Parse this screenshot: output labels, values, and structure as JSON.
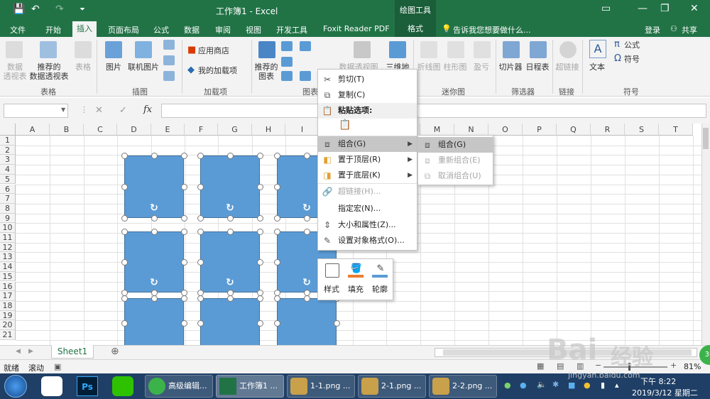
{
  "titlebar": {
    "title": "工作簿1 - Excel",
    "context_tool": "绘图工具",
    "save_icon": "save-icon"
  },
  "tabs": {
    "file": "文件",
    "home": "开始",
    "insert": "插入",
    "layout": "页面布局",
    "formulas": "公式",
    "data": "数据",
    "review": "审阅",
    "view": "视图",
    "developer": "开发工具",
    "foxit": "Foxit Reader PDF",
    "format": "格式",
    "tell": "告诉我您想要做什么...",
    "login": "登录",
    "share": "共享"
  },
  "ribbon": {
    "pivot": "数据\n透视表",
    "rec_pivot": "推荐的\n数据透视表",
    "table": "表格",
    "group_table": "表格",
    "picture": "图片",
    "online_pic": "联机图片",
    "group_illus": "插图",
    "store": "应用商店",
    "my_addins": "我的加载项",
    "group_addins": "加载项",
    "rec_chart": "推荐的\n图表",
    "group_chart": "图表",
    "pivot_chart": "数据透视图",
    "map3d": "三维地",
    "line": "折线图",
    "column": "柱形图",
    "winloss": "盈亏",
    "group_spark": "迷你图",
    "slicer": "切片器",
    "timeline": "日程表",
    "group_filter": "筛选器",
    "hyperlink": "超链接",
    "group_link": "链接",
    "text": "文本",
    "formula": "公式",
    "symbol": "符号",
    "group_symbol": "符号"
  },
  "formula_bar": {
    "fx": "fx",
    "cancel": "✕",
    "enter": "✓"
  },
  "columns": [
    "A",
    "B",
    "C",
    "D",
    "E",
    "F",
    "G",
    "H",
    "I",
    "J",
    "K",
    "L",
    "M",
    "N",
    "O",
    "P",
    "Q",
    "R",
    "S",
    "T"
  ],
  "rows": [
    "1",
    "2",
    "3",
    "4",
    "5",
    "6",
    "7",
    "8",
    "9",
    "10",
    "11",
    "12",
    "13",
    "14",
    "15",
    "16",
    "17",
    "18",
    "19",
    "20",
    "21"
  ],
  "context_menu": {
    "cut": "剪切(T)",
    "copy": "复制(C)",
    "paste_options": "粘贴选项:",
    "group": "组合(G)",
    "bring_front": "置于顶层(R)",
    "send_back": "置于底层(K)",
    "hyperlink": "超链接(H)...",
    "assign_macro": "指定宏(N)...",
    "size_props": "大小和属性(Z)...",
    "format_object": "设置对象格式(O)..."
  },
  "submenu": {
    "group": "组合(G)",
    "regroup": "重新组合(E)",
    "ungroup": "取消组合(U)"
  },
  "minibar": {
    "style": "样式",
    "fill": "填充",
    "outline": "轮廓",
    "fill_color": "#ed7d31",
    "outline_color": "#5b9bd5"
  },
  "sheets": {
    "active": "Sheet1"
  },
  "status": {
    "ready": "就绪",
    "scroll": "滚动",
    "zoom": "81%"
  },
  "taskbar": {
    "items": [
      "高级编辑...",
      "工作簿1 ...",
      "1-1.png ...",
      "2-1.png ...",
      "2-2.png ..."
    ],
    "time": "下午 8:22",
    "date": "2019/3/12 星期二"
  },
  "watermark": {
    "text": "Bai",
    "sub": "jingyan.baidu.com",
    "cn": "经验"
  },
  "colors": {
    "excel_green": "#217346",
    "shape_fill": "#5b9bd5",
    "shape_border": "#41719c"
  }
}
